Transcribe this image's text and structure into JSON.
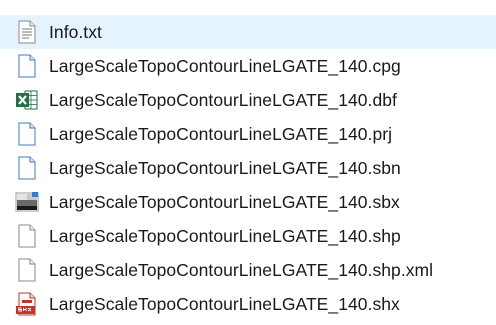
{
  "file_list": {
    "selected_index": 0,
    "items": [
      {
        "name": "Info.txt",
        "icon": "text-document-icon"
      },
      {
        "name": "LargeScaleTopoContourLineLGATE_140.cpg",
        "icon": "generic-file-icon"
      },
      {
        "name": "LargeScaleTopoContourLineLGATE_140.dbf",
        "icon": "excel-icon"
      },
      {
        "name": "LargeScaleTopoContourLineLGATE_140.prj",
        "icon": "generic-file-icon"
      },
      {
        "name": "LargeScaleTopoContourLineLGATE_140.sbn",
        "icon": "generic-file-icon"
      },
      {
        "name": "LargeScaleTopoContourLineLGATE_140.sbx",
        "icon": "image-file-icon"
      },
      {
        "name": "LargeScaleTopoContourLineLGATE_140.shp",
        "icon": "generic-file-icon"
      },
      {
        "name": "LargeScaleTopoContourLineLGATE_140.shp.xml",
        "icon": "generic-file-icon"
      },
      {
        "name": "LargeScaleTopoContourLineLGATE_140.shx",
        "icon": "shx-file-icon"
      }
    ]
  },
  "colors": {
    "selection_background": "#e5f3ff",
    "text": "#1a1a1a",
    "excel_green": "#1d7144",
    "shx_red": "#c0362c"
  }
}
